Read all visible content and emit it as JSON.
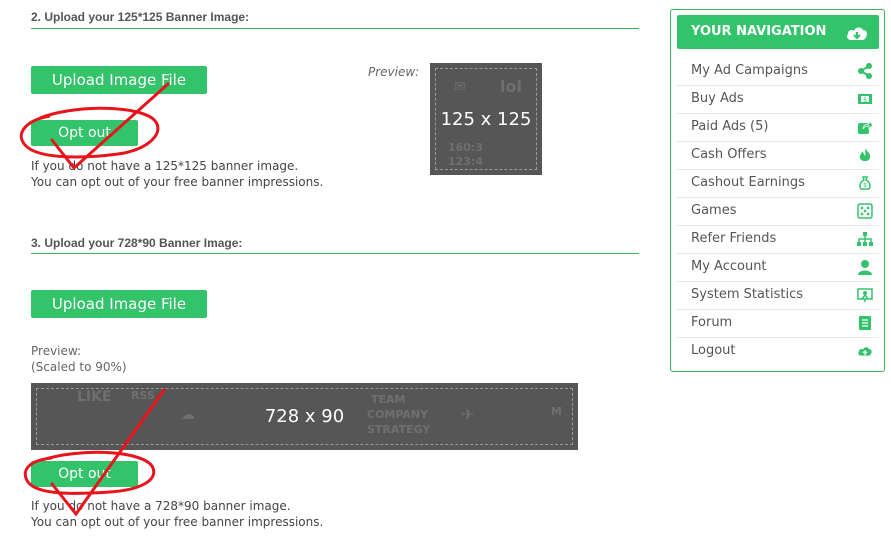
{
  "sections": [
    {
      "title": "2. Upload your 125*125 Banner Image:",
      "upload_label": "Upload Image File",
      "opt_out_label": "Opt out",
      "preview_label": "Preview:",
      "banner_text": "125 x 125",
      "note_line1": "If you do not have a 125*125 banner image.",
      "note_line2": "You can opt out of your free banner impressions."
    },
    {
      "title": "3. Upload your 728*90 Banner Image:",
      "upload_label": "Upload Image File",
      "opt_out_label": "Opt out",
      "preview_label": "Preview:",
      "preview_sub": "(Scaled to 90%)",
      "banner_text": "728 x 90",
      "note_line1": "If you do not have a 728*90 banner image.",
      "note_line2": "You can opt out of your free banner impressions."
    }
  ],
  "navigation": {
    "header": "YOUR NAVIGATION",
    "header_icon": "cloud-download-icon",
    "items": [
      {
        "label": "My Ad Campaigns",
        "icon": "share-icon"
      },
      {
        "label": "Buy Ads",
        "icon": "money-icon"
      },
      {
        "label": "Paid Ads (5)",
        "icon": "share-square-icon"
      },
      {
        "label": "Cash Offers",
        "icon": "fire-icon"
      },
      {
        "label": "Cashout Earnings",
        "icon": "money-bag-icon"
      },
      {
        "label": "Games",
        "icon": "dice-icon"
      },
      {
        "label": "Refer Friends",
        "icon": "sitemap-icon"
      },
      {
        "label": "My Account",
        "icon": "user-icon"
      },
      {
        "label": "System Statistics",
        "icon": "presentation-icon"
      },
      {
        "label": "Forum",
        "icon": "book-icon"
      },
      {
        "label": "Logout",
        "icon": "cloud-upload-icon"
      }
    ]
  },
  "colors": {
    "accent_green": "#33c36b",
    "annotation_red": "#e8141c",
    "banner_gray": "#565656"
  }
}
